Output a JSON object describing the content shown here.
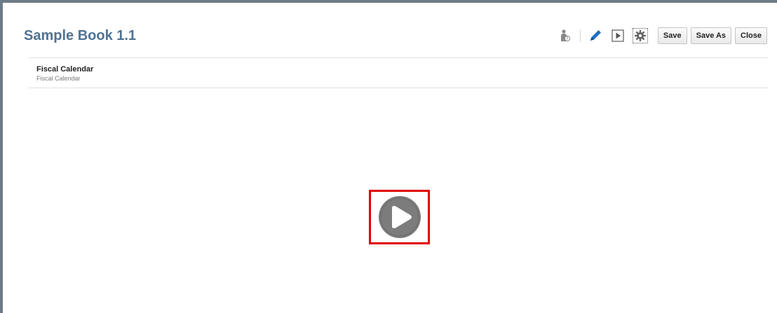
{
  "header": {
    "title": "Sample Book 1.1"
  },
  "toolbar": {
    "icons": [
      "user-help-icon",
      "pencil-icon",
      "run-icon",
      "gear-icon"
    ],
    "save_label": "Save",
    "save_as_label": "Save As",
    "close_label": "Close"
  },
  "content": {
    "item_title": "Fiscal Calendar",
    "item_subtitle": "Fiscal Calendar"
  },
  "colors": {
    "title": "#4f7293",
    "pencil": "#1f6fc4",
    "highlight_border": "#e00000",
    "play_circle": "#7c7c7c"
  }
}
